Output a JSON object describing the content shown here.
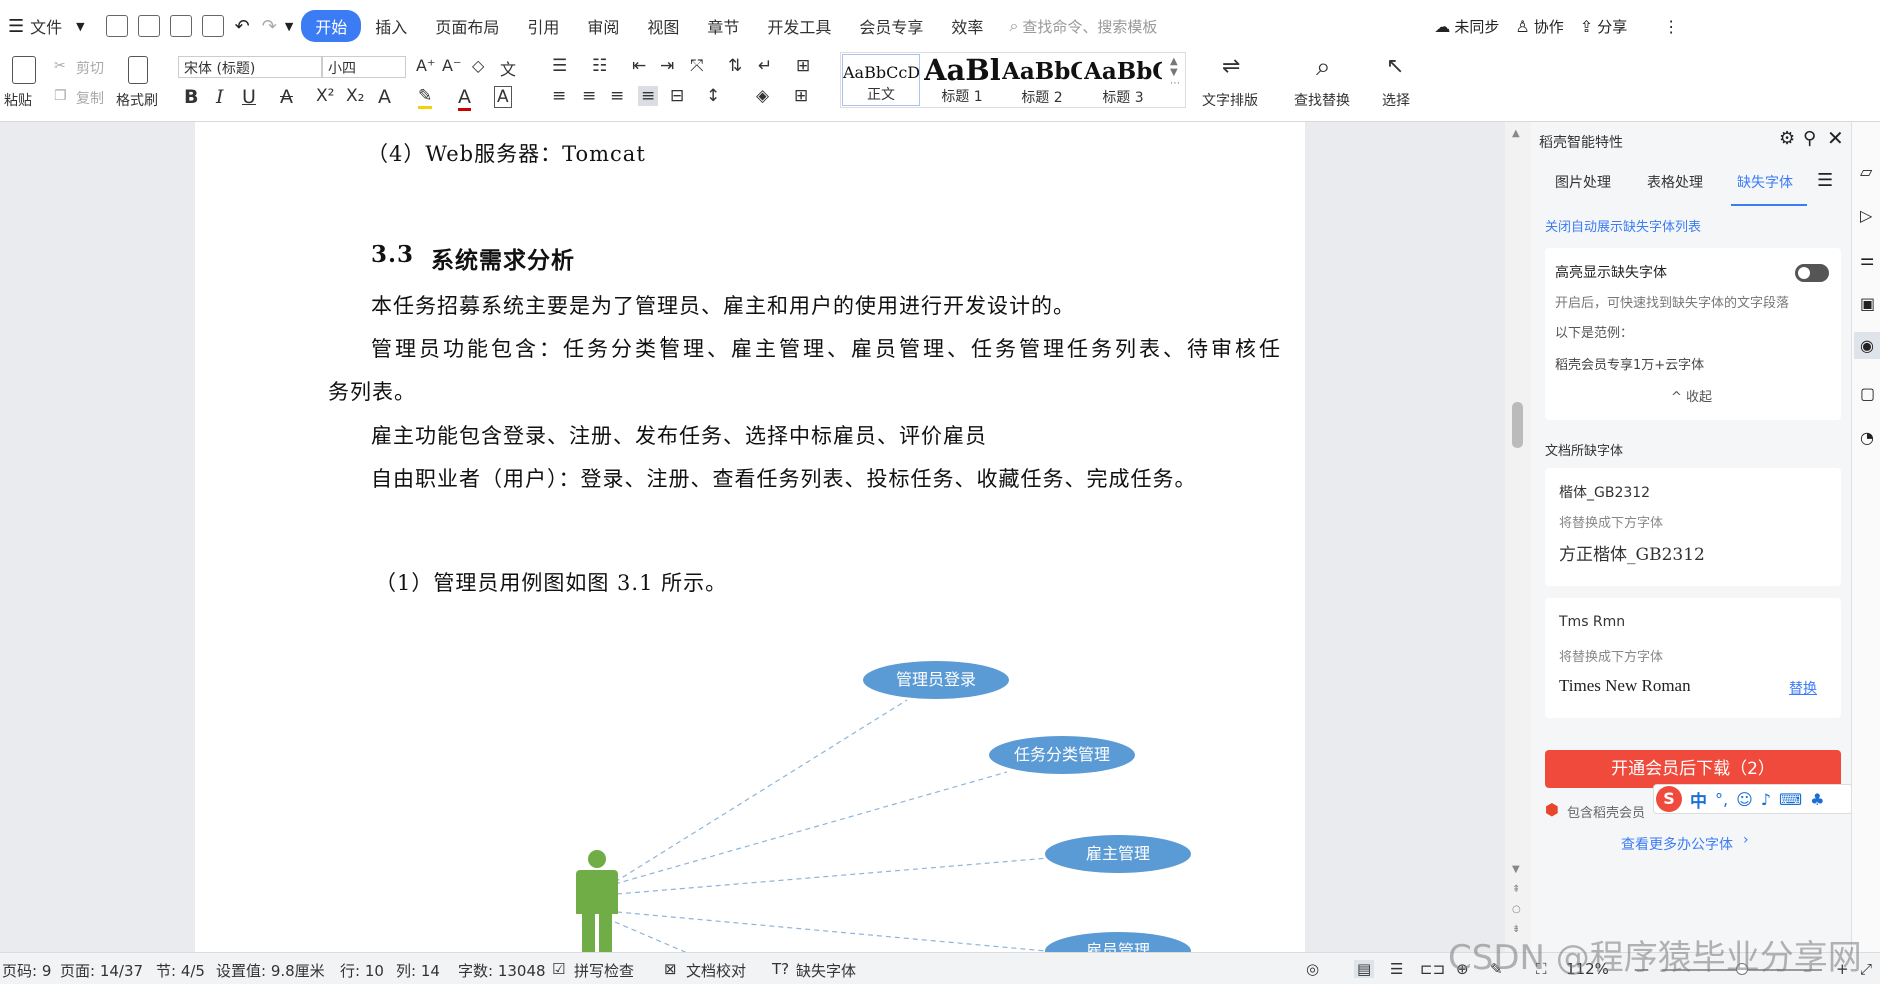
{
  "menubar": {
    "file": "文件",
    "tabs": [
      "开始",
      "插入",
      "页面布局",
      "引用",
      "审阅",
      "视图",
      "章节",
      "开发工具",
      "会员专享",
      "效率"
    ],
    "search": "查找命令、搜索模板",
    "unsync": "未同步",
    "collab": "协作",
    "share": "分享"
  },
  "ribbon": {
    "paste": "粘贴",
    "cut": "剪切",
    "copy": "复制",
    "format_painter": "格式刷",
    "font_name": "宋体 (标题)",
    "font_size": "小四",
    "text_layout": "文字排版",
    "find_replace": "查找替换",
    "select": "选择",
    "styles": [
      {
        "preview": "AaBbCcDd",
        "name": "正文"
      },
      {
        "preview": "AaBl",
        "name": "标题 1"
      },
      {
        "preview": "AaBbC",
        "name": "标题 2"
      },
      {
        "preview": "AaBbC",
        "name": "标题 3"
      }
    ]
  },
  "doc": {
    "line_web": "（4）Web服务器：Tomcat",
    "heading_num": "3.3",
    "heading": "系统需求分析",
    "p1": "本任务招募系统主要是为了管理员、雇主和用户的使用进行开发设计的。",
    "p2a": "管理员功能包含：任务分类管理、雇主管理、雇员管理、任务管理任务列表、待审核任",
    "p2b": "务列表。",
    "p3": "雇主功能包含登录、注册、发布任务、选择中标雇员、评价雇员",
    "p4": "自由职业者（用户）：登录、注册、查看任务列表、投标任务、收藏任务、完成任务。",
    "p5": "（1）管理员用例图如图 3.1 所示。",
    "usecases": [
      "管理员登录",
      "任务分类管理",
      "雇主管理",
      "雇员管理"
    ]
  },
  "panel": {
    "title": "稻壳智能特性",
    "tabs": [
      "图片处理",
      "表格处理",
      "缺失字体"
    ],
    "auto_link": "关闭自动展示缺失字体列表",
    "highlight_title": "高亮显示缺失字体",
    "highlight_desc": "开启后，可快速找到缺失字体的文字段落",
    "example_label": "以下是范例：",
    "example_text": "稻壳会员专享1万+云字体",
    "collapse": "收起",
    "missing_title": "文档所缺字体",
    "fonts": [
      {
        "name": "楷体_GB2312",
        "replace_label": "将替换成下方字体",
        "replacement": "方正楷体_GB2312"
      },
      {
        "name": "Tms Rmn",
        "replace_label": "将替换成下方字体",
        "replacement": "Times New Roman",
        "action": "替换"
      }
    ],
    "download_btn": "开通会员后下载（2）",
    "member_note": "包含稻壳会员",
    "more_link": "查看更多办公字体"
  },
  "ime": {
    "zh": "中"
  },
  "status": {
    "page": "页码: 9",
    "pages": "页面: 14/37",
    "section": "节: 4/5",
    "setting": "设置值: 9.8厘米",
    "row": "行: 10",
    "col": "列: 14",
    "words": "字数: 13048",
    "spell": "拼写检查",
    "proof": "文档校对",
    "missing_font": "缺失字体",
    "zoom": "112%",
    "watermark": "CSDN @程序猿毕业分享网"
  },
  "colors": {
    "accent": "#3b7cf5",
    "download": "#f04a3c",
    "ellipse": "#5b9bd5",
    "actor": "#70ad47"
  }
}
